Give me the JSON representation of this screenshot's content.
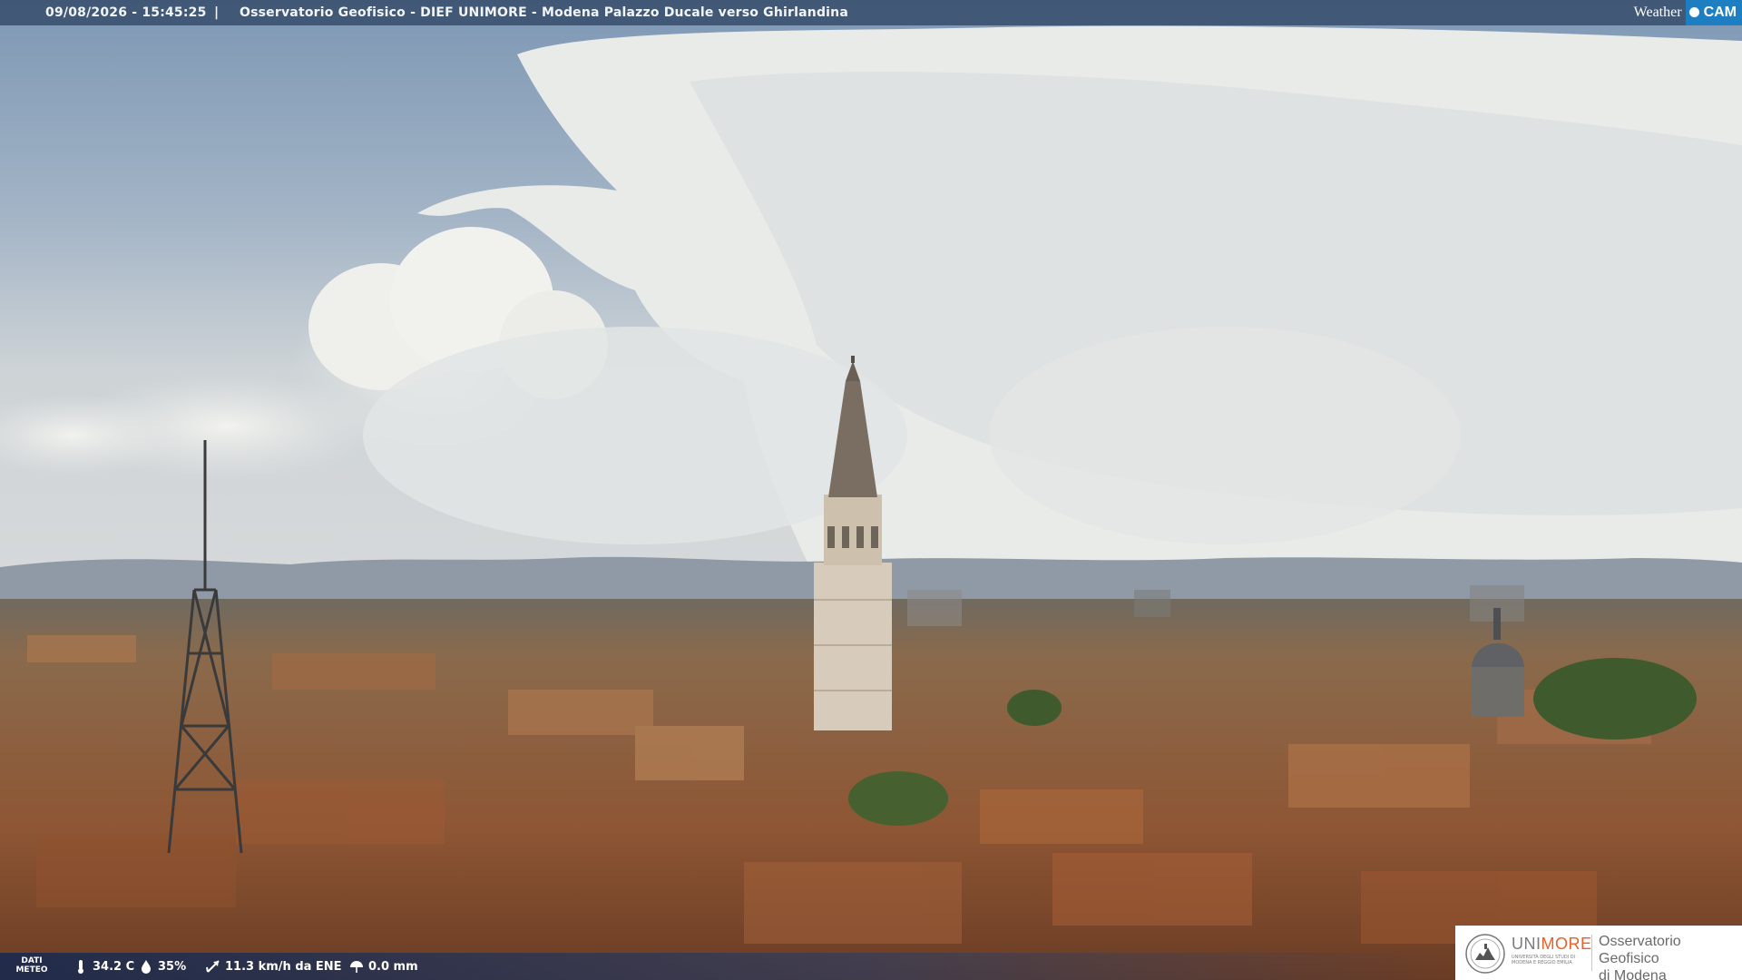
{
  "header": {
    "timestamp": "09/08/2026 - 15:45:25",
    "separator": "|",
    "location": "Osservatorio Geofisico - DIEF UNIMORE - Modena Palazzo Ducale verso Ghirlandina"
  },
  "logo": {
    "word1": "Weather",
    "word2": "CAM"
  },
  "meteo": {
    "label_line1": "DATI",
    "label_line2": "METEO",
    "temperature": "34.2 C",
    "humidity": "35%",
    "wind": "11.3 km/h da ENE",
    "rain": "0.0 mm"
  },
  "badge": {
    "uni_prefix": "UNI",
    "uni_suffix": "MORE",
    "uni_sub": "UNIVERSITÀ DEGLI STUDI DI MODENA E REGGIO EMILIA",
    "obs_line1": "Osservatorio Geofisico",
    "obs_line2": "di Modena"
  },
  "colors": {
    "sky_top": "#7f98b5",
    "cloud": "#eef0ee",
    "roof": "#9a5f3a",
    "tower": "#d2c6b4",
    "accent_orange": "#e8612a",
    "accent_blue": "#1d7fc2"
  }
}
